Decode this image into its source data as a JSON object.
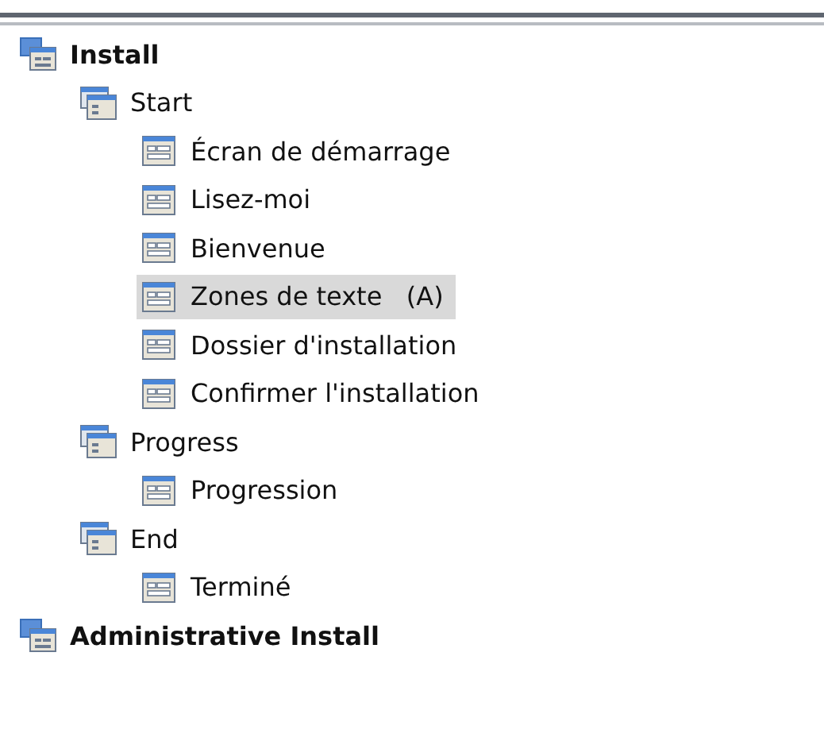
{
  "tree": [
    {
      "label": "Install",
      "kind": "root",
      "selected": false,
      "children": [
        {
          "label": "Start",
          "kind": "group",
          "selected": false,
          "children": [
            {
              "label": "Écran de démarrage",
              "kind": "page",
              "selected": false
            },
            {
              "label": "Lisez-moi",
              "kind": "page",
              "selected": false
            },
            {
              "label": "Bienvenue",
              "kind": "page",
              "selected": false
            },
            {
              "label": "Zones de texte   (A)",
              "kind": "page",
              "selected": true
            },
            {
              "label": "Dossier d'installation",
              "kind": "page",
              "selected": false
            },
            {
              "label": "Confirmer l'installation",
              "kind": "page",
              "selected": false
            }
          ]
        },
        {
          "label": "Progress",
          "kind": "group",
          "selected": false,
          "children": [
            {
              "label": "Progression",
              "kind": "page",
              "selected": false
            }
          ]
        },
        {
          "label": "End",
          "kind": "group",
          "selected": false,
          "children": [
            {
              "label": "Terminé",
              "kind": "page",
              "selected": false
            }
          ]
        }
      ]
    },
    {
      "label": "Administrative Install",
      "kind": "root",
      "selected": false
    }
  ]
}
